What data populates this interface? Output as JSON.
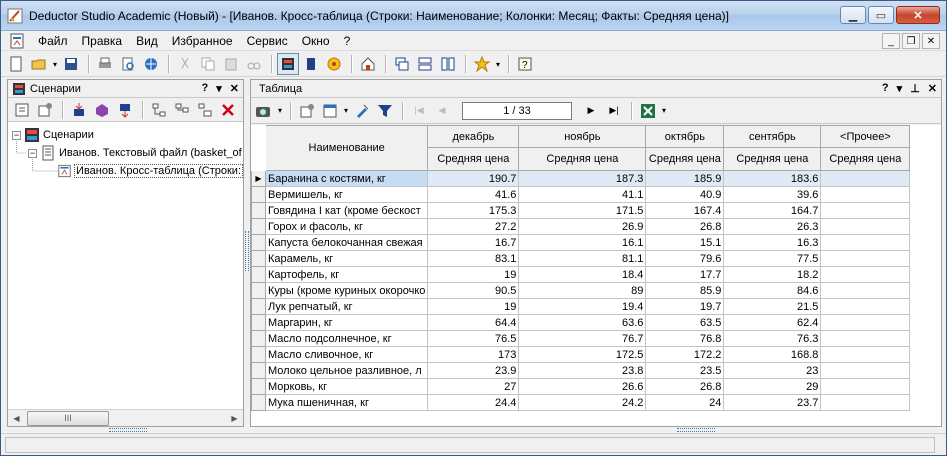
{
  "window": {
    "title": "Deductor Studio Academic (Новый) - [Иванов. Кросс-таблица (Строки: Наименование; Колонки: Месяц; Факты: Средняя цена)]"
  },
  "menu": {
    "items": [
      {
        "label": "Файл"
      },
      {
        "label": "Правка"
      },
      {
        "label": "Вид"
      },
      {
        "label": "Избранное"
      },
      {
        "label": "Сервис"
      },
      {
        "label": "Окно"
      },
      {
        "label": "?"
      }
    ]
  },
  "left_panel": {
    "title": "Сценарии",
    "help": "?",
    "tree": [
      {
        "label": "Сценарии",
        "level": 0
      },
      {
        "label": "Иванов. Текстовый файл (basket_of",
        "level": 1
      },
      {
        "label": "Иванов. Кросс-таблица (Строки:",
        "level": 2
      }
    ],
    "scroll_grip": "III"
  },
  "right_panel": {
    "title": "Таблица",
    "help": "?",
    "pager": "1 / 33"
  },
  "table": {
    "row_header": "Наименование",
    "columns": [
      {
        "month": "декабрь",
        "measure": "Средняя цена"
      },
      {
        "month": "ноябрь",
        "measure": "Средняя цена"
      },
      {
        "month": "октябрь",
        "measure": "Средняя цена"
      },
      {
        "month": "сентябрь",
        "measure": "Средняя цена"
      },
      {
        "month": "<Прочее>",
        "measure": "Средняя цена"
      }
    ],
    "rows": [
      {
        "name": "Баранина с костями, кг",
        "v": [
          "190.7",
          "187.3",
          "185.9",
          "183.6",
          ""
        ]
      },
      {
        "name": "Вермишель, кг",
        "v": [
          "41.6",
          "41.1",
          "40.9",
          "39.6",
          ""
        ]
      },
      {
        "name": "Говядина I кат (кроме бескост",
        "v": [
          "175.3",
          "171.5",
          "167.4",
          "164.7",
          ""
        ]
      },
      {
        "name": "Горох и фасоль, кг",
        "v": [
          "27.2",
          "26.9",
          "26.8",
          "26.3",
          ""
        ]
      },
      {
        "name": "Капуста белокочанная свежая",
        "v": [
          "16.7",
          "16.1",
          "15.1",
          "16.3",
          ""
        ]
      },
      {
        "name": "Карамель, кг",
        "v": [
          "83.1",
          "81.1",
          "79.6",
          "77.5",
          ""
        ]
      },
      {
        "name": "Картофель, кг",
        "v": [
          "19",
          "18.4",
          "17.7",
          "18.2",
          ""
        ]
      },
      {
        "name": "Куры (кроме куриных окорочко",
        "v": [
          "90.5",
          "89",
          "85.9",
          "84.6",
          ""
        ]
      },
      {
        "name": "Лук репчатый, кг",
        "v": [
          "19",
          "19.4",
          "19.7",
          "21.5",
          ""
        ]
      },
      {
        "name": "Маргарин, кг",
        "v": [
          "64.4",
          "63.6",
          "63.5",
          "62.4",
          ""
        ]
      },
      {
        "name": "Масло подсолнечное, кг",
        "v": [
          "76.5",
          "76.7",
          "76.8",
          "76.3",
          ""
        ]
      },
      {
        "name": "Масло сливочное, кг",
        "v": [
          "173",
          "172.5",
          "172.2",
          "168.8",
          ""
        ]
      },
      {
        "name": "Молоко цельное разливное, л",
        "v": [
          "23.9",
          "23.8",
          "23.5",
          "23",
          ""
        ]
      },
      {
        "name": "Морковь, кг",
        "v": [
          "27",
          "26.6",
          "26.8",
          "29",
          ""
        ]
      },
      {
        "name": "Мука пшеничная, кг",
        "v": [
          "24.4",
          "24.2",
          "24",
          "23.7",
          ""
        ]
      }
    ]
  },
  "colors": {
    "selected_row": "#c5dcf3",
    "close_button": "#c7452e"
  }
}
